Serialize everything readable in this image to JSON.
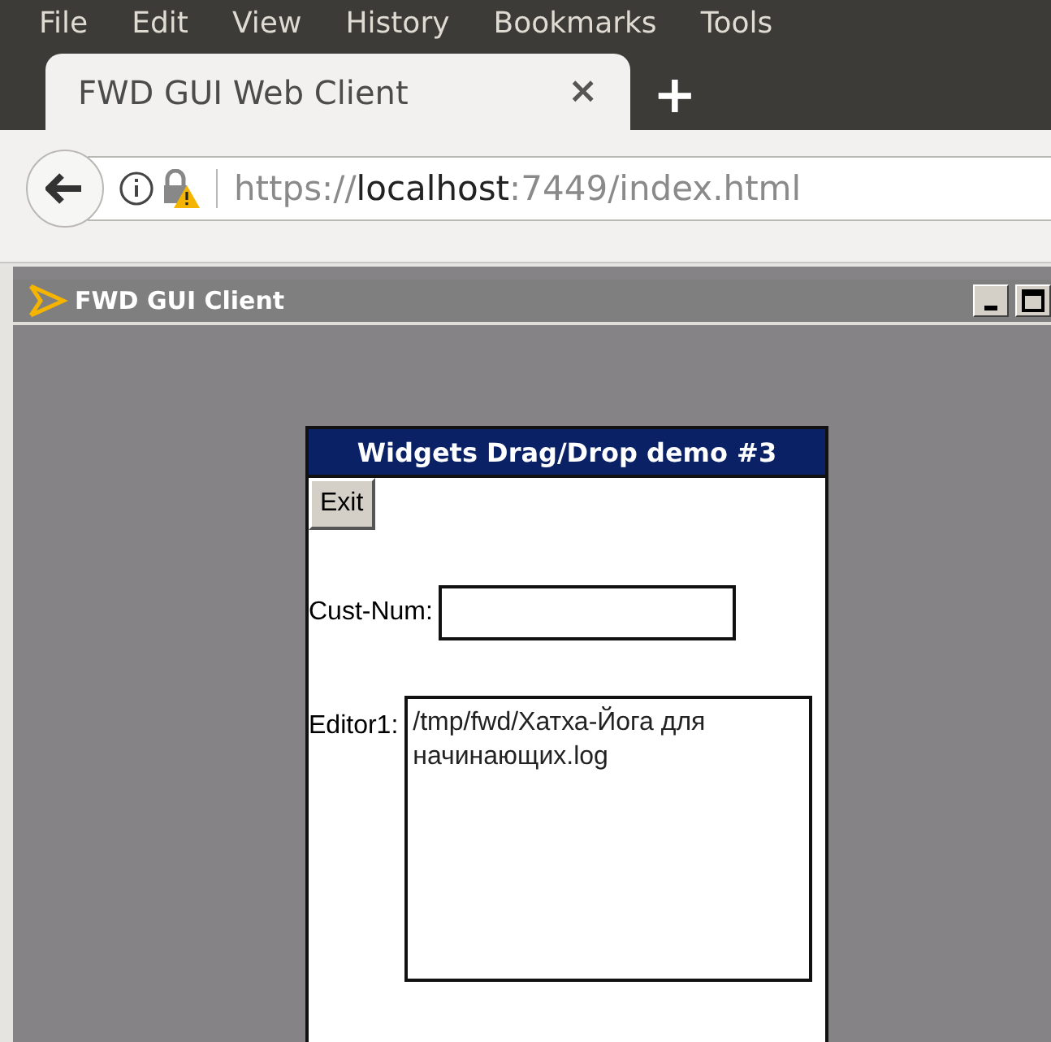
{
  "menu": [
    {
      "label": "File"
    },
    {
      "label": "Edit"
    },
    {
      "label": "View"
    },
    {
      "label": "History"
    },
    {
      "label": "Bookmarks"
    },
    {
      "label": "Tools"
    }
  ],
  "tabs": [
    {
      "label": "FWD GUI Web Client",
      "selected": true,
      "close": "×"
    }
  ],
  "new_tab": "+",
  "address": {
    "scheme": "https://",
    "host": "localhost",
    "rest": ":7449/index.html"
  },
  "app_window": {
    "title": "FWD GUI Client"
  },
  "dialog": {
    "title": "Widgets Drag/Drop demo #3",
    "exit_button": "Exit",
    "cust_num": {
      "label": "Cust-Num:"
    },
    "editor": {
      "label": "Editor1:",
      "value": "/tmp/fwd/Хатха-Йога для начинающих.log"
    }
  }
}
